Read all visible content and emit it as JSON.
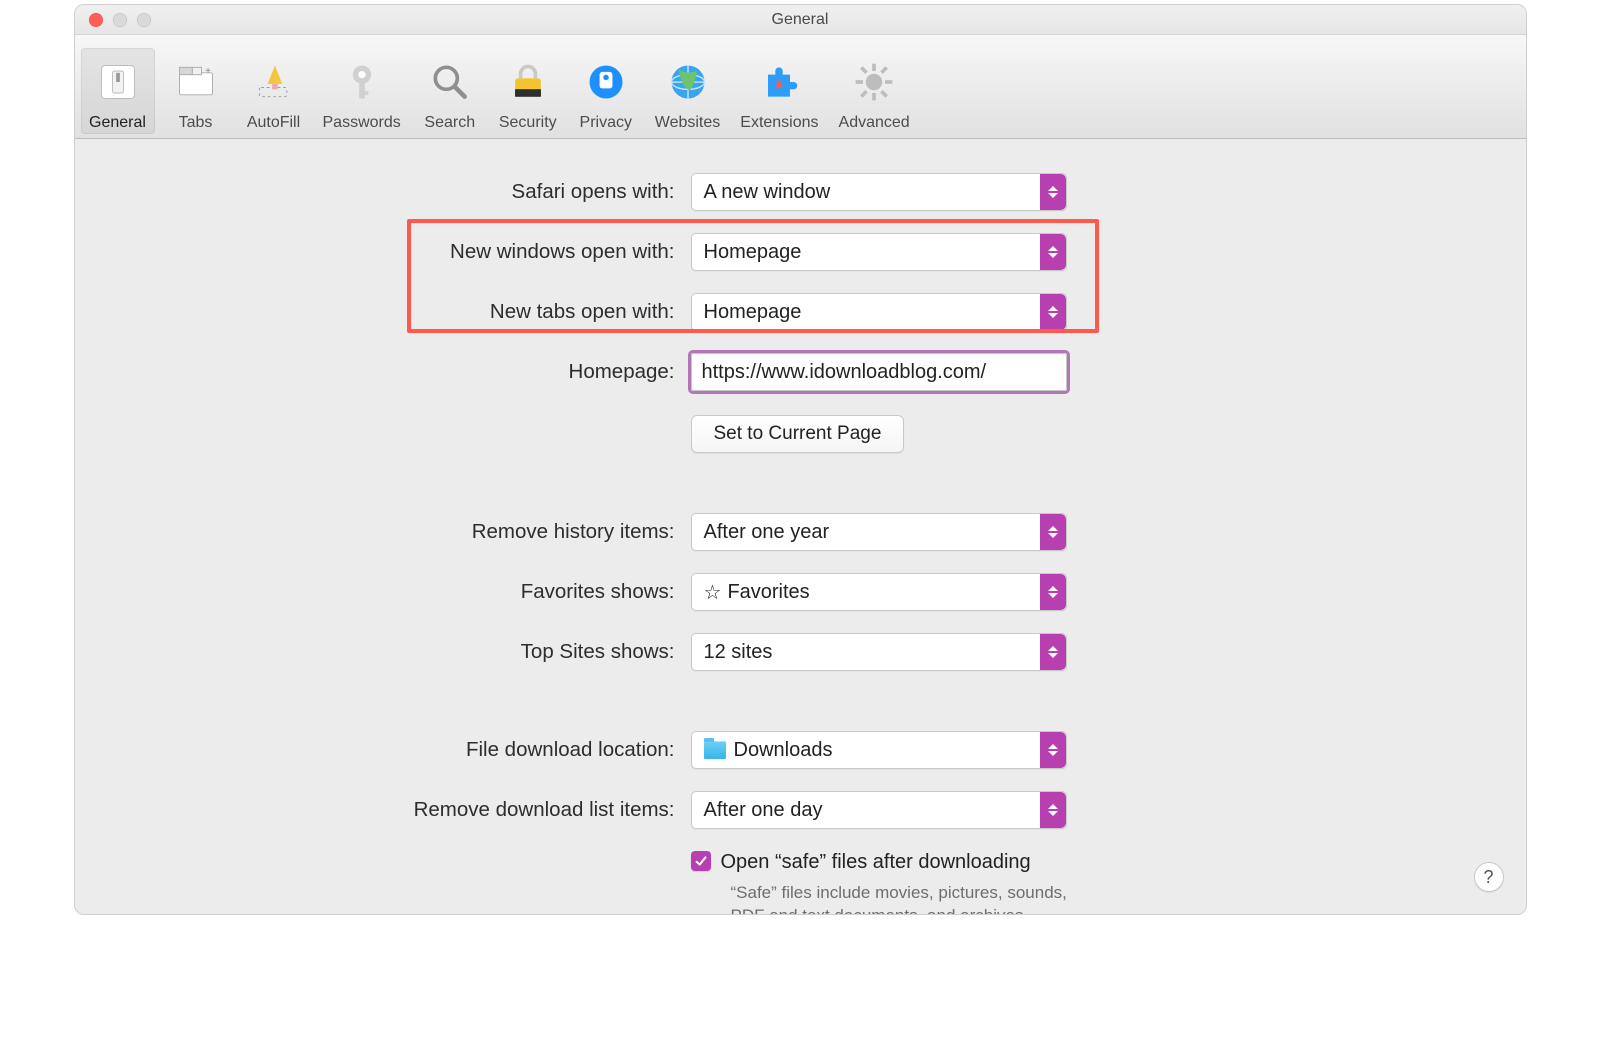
{
  "window": {
    "title": "General"
  },
  "toolbar": {
    "items": [
      {
        "id": "general",
        "label": "General"
      },
      {
        "id": "tabs",
        "label": "Tabs"
      },
      {
        "id": "autofill",
        "label": "AutoFill"
      },
      {
        "id": "passwords",
        "label": "Passwords"
      },
      {
        "id": "search",
        "label": "Search"
      },
      {
        "id": "security",
        "label": "Security"
      },
      {
        "id": "privacy",
        "label": "Privacy"
      },
      {
        "id": "websites",
        "label": "Websites"
      },
      {
        "id": "extensions",
        "label": "Extensions"
      },
      {
        "id": "advanced",
        "label": "Advanced"
      }
    ],
    "selected": "general"
  },
  "form": {
    "safari_opens_with": {
      "label": "Safari opens with:",
      "value": "A new window"
    },
    "new_windows_open_with": {
      "label": "New windows open with:",
      "value": "Homepage"
    },
    "new_tabs_open_with": {
      "label": "New tabs open with:",
      "value": "Homepage"
    },
    "homepage": {
      "label": "Homepage:",
      "value": "https://www.idownloadblog.com/"
    },
    "set_current_page_button": "Set to Current Page",
    "remove_history": {
      "label": "Remove history items:",
      "value": "After one year"
    },
    "favorites_shows": {
      "label": "Favorites shows:",
      "value": "Favorites"
    },
    "top_sites_shows": {
      "label": "Top Sites shows:",
      "value": "12 sites"
    },
    "download_location": {
      "label": "File download location:",
      "value": "Downloads"
    },
    "remove_downloads": {
      "label": "Remove download list items:",
      "value": "After one day"
    },
    "open_safe_files": {
      "checked": true,
      "label": "Open “safe” files after downloading",
      "hint": "“Safe” files include movies, pictures, sounds, PDF and text documents, and archives."
    }
  },
  "annotations": {
    "highlight_red_rows": [
      "new_windows_open_with",
      "new_tabs_open_with"
    ],
    "highlight_purple_field": "homepage"
  },
  "colors": {
    "accent": "#b83fb0",
    "highlight_red": "#ff5a4c",
    "highlight_purple": "#b275b8"
  },
  "help_button": "?"
}
